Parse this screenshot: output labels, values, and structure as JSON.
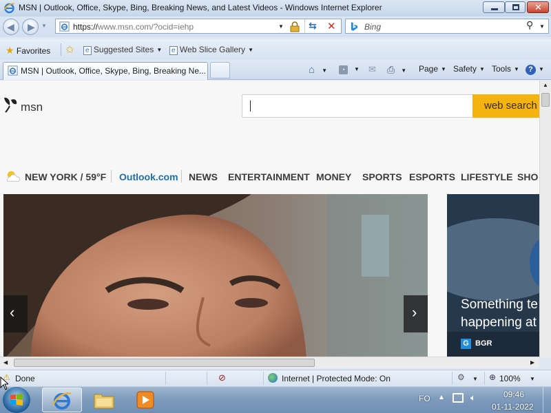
{
  "window": {
    "title": "MSN | Outlook, Office, Skype, Bing, Breaking News, and Latest Videos - Windows Internet Explorer"
  },
  "address_bar": {
    "url_prefix": "https://",
    "url_host": "www.msn.com",
    "url_path": "/?ocid=iehp"
  },
  "search_bar": {
    "placeholder": "Bing"
  },
  "favorites_bar": {
    "favorites_label": "Favorites",
    "suggested_sites_label": "Suggested Sites",
    "web_slice_gallery_label": "Web Slice Gallery"
  },
  "tab": {
    "label": "MSN | Outlook, Office, Skype, Bing, Breaking Ne..."
  },
  "command_bar": {
    "page_label": "Page",
    "safety_label": "Safety",
    "tools_label": "Tools"
  },
  "msn": {
    "logo_text": "msn",
    "search_button_label": "web search",
    "weather_label": "NEW YORK / 59°F",
    "nav": [
      "Outlook.com",
      "NEWS",
      "ENTERTAINMENT",
      "MONEY",
      "SPORTS",
      "ESPORTS",
      "LIFESTYLE",
      "SHO"
    ],
    "side_headline_line1": "Something te",
    "side_headline_line2": "happening at",
    "side_source": "BGR"
  },
  "status_bar": {
    "status_text": "Done",
    "zone_text": "Internet | Protected Mode: On",
    "zoom_text": "100%"
  },
  "taskbar": {
    "language": "FO",
    "time": "09:46",
    "date": "01-11-2022"
  }
}
